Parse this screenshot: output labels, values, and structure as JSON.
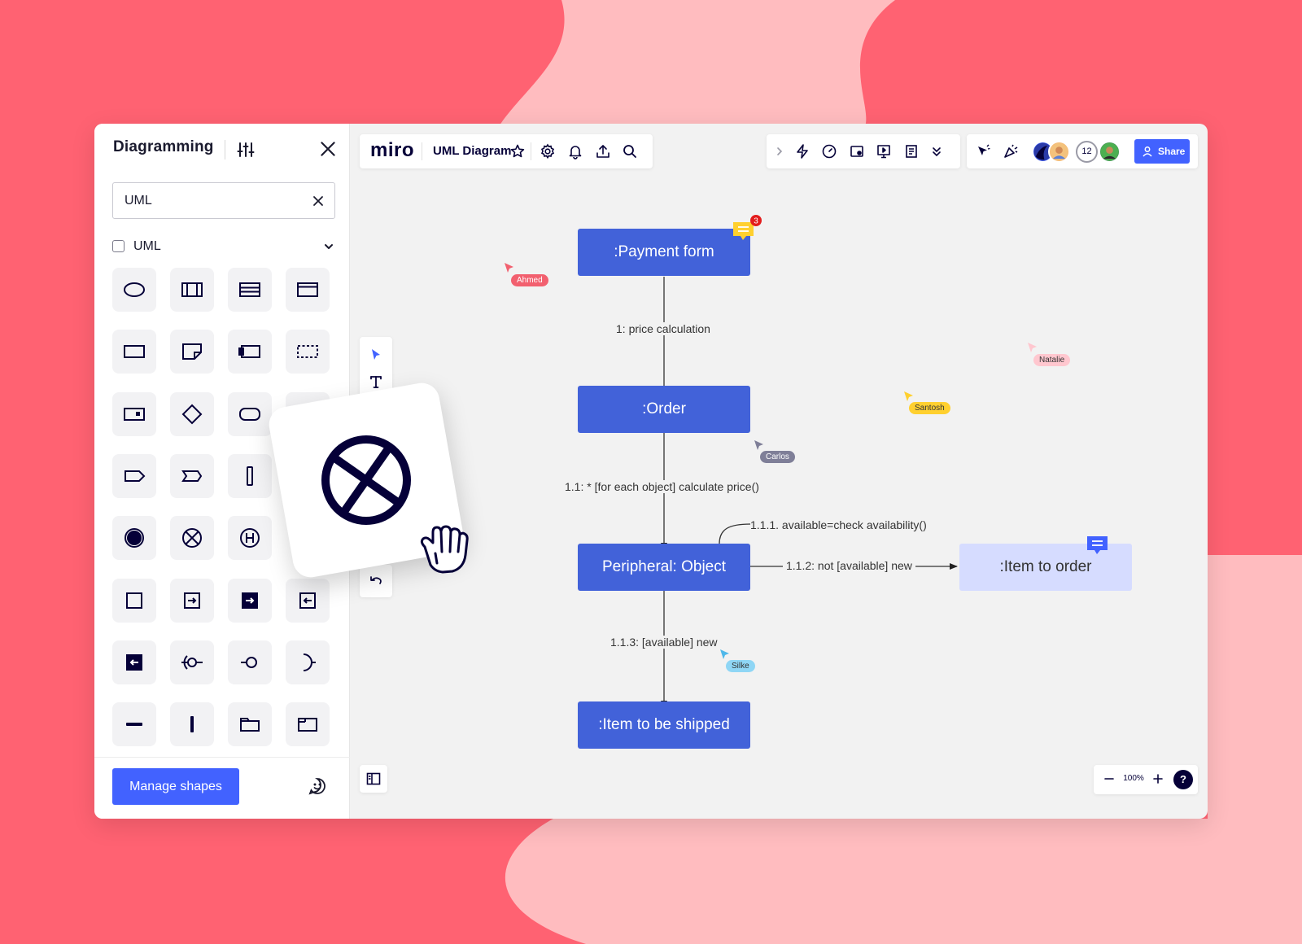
{
  "sidebar": {
    "title": "Diagramming",
    "search_value": "UML",
    "category_label": "UML",
    "manage_label": "Manage shapes",
    "shapes": [
      "ellipse-shape",
      "class-shape",
      "list-shape",
      "window-shape",
      "rectangle-shape",
      "note-shape",
      "component-shape",
      "dashed-rectangle-shape",
      "port-shape",
      "diamond-shape",
      "rounded-rectangle-shape",
      "frame-shape",
      "pentagon-shape",
      "chevron-shape",
      "vertical-bar-shape",
      "blank-shape",
      "initial-state-shape",
      "flow-final-shape",
      "history-shape",
      "blank-shape",
      "square-shape",
      "entry-shape",
      "entry-filled-shape",
      "exit-shape",
      "exit-filled-shape",
      "provided-interface-shape",
      "lollipop-shape",
      "required-interface-shape",
      "horizontal-line-shape",
      "vertical-line-shape",
      "folder-shape",
      "package-shape"
    ]
  },
  "topbar": {
    "logo": "miro",
    "board_name": "UML Diagram",
    "share_label": "Share",
    "collaborator_count": "12"
  },
  "zoom": {
    "level": "100%",
    "help": "?"
  },
  "diagram": {
    "nodes": {
      "payment": ":Payment form",
      "order": ":Order",
      "peripheral": "Peripheral: Object",
      "item_order": ":Item to order",
      "item_shipped": ":Item to be shipped"
    },
    "edges": {
      "e1": "1: price calculation",
      "e2": "1.1: * [for each object] calculate price()",
      "e3": "1.1.1. available=check availability()",
      "e4": "1.1.2: not [available] new",
      "e5": "1.1.3: [available] new"
    },
    "comment_count": "3"
  },
  "cursors": [
    {
      "name": "Ahmed",
      "color": "#f2606f",
      "text_color": "#ffffff"
    },
    {
      "name": "Natalie",
      "color": "#ffc7cf",
      "text_color": "#333333"
    },
    {
      "name": "Santosh",
      "color": "#ffd02f",
      "text_color": "#333333"
    },
    {
      "name": "Carlos",
      "color": "#7f7f98",
      "text_color": "#ffffff"
    },
    {
      "name": "Silke",
      "color": "#8fd6f5",
      "text_color": "#333333"
    }
  ],
  "colors": {
    "accent": "#4262ff",
    "node": "#4262d9",
    "node_light": "#d6dcff",
    "bg_red": "#ff6272",
    "bg_pink": "#ffbcbf"
  }
}
